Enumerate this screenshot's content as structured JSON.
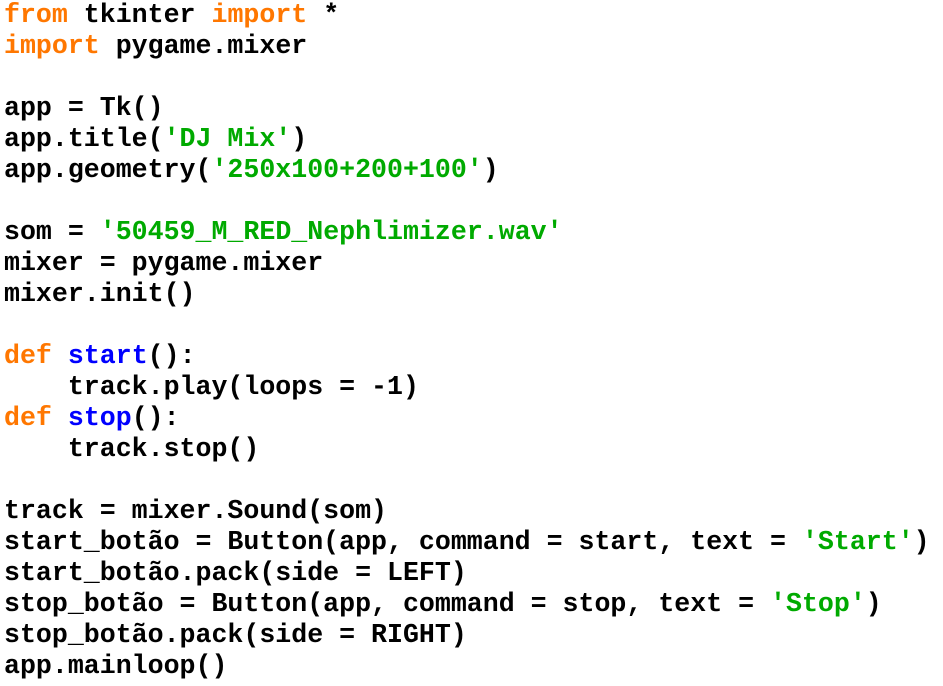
{
  "editor": {
    "colors": {
      "background": "#ffffff",
      "plain": "#000000",
      "keyword": "#ff7700",
      "function_name": "#0000ff",
      "string": "#00aa00"
    },
    "lines": [
      [
        {
          "t": "kw",
          "v": "from"
        },
        {
          "t": "plain",
          "v": " tkinter "
        },
        {
          "t": "kw",
          "v": "import"
        },
        {
          "t": "plain",
          "v": " *"
        }
      ],
      [
        {
          "t": "kw",
          "v": "import"
        },
        {
          "t": "plain",
          "v": " pygame.mixer"
        }
      ],
      [],
      [
        {
          "t": "plain",
          "v": "app = Tk()"
        }
      ],
      [
        {
          "t": "plain",
          "v": "app.title("
        },
        {
          "t": "str",
          "v": "'DJ Mix'"
        },
        {
          "t": "plain",
          "v": ")"
        }
      ],
      [
        {
          "t": "plain",
          "v": "app.geometry("
        },
        {
          "t": "str",
          "v": "'250x100+200+100'"
        },
        {
          "t": "plain",
          "v": ")"
        }
      ],
      [],
      [
        {
          "t": "plain",
          "v": "som = "
        },
        {
          "t": "str",
          "v": "'50459_M_RED_Nephlimizer.wav'"
        }
      ],
      [
        {
          "t": "plain",
          "v": "mixer = pygame.mixer"
        }
      ],
      [
        {
          "t": "plain",
          "v": "mixer.init()"
        }
      ],
      [],
      [
        {
          "t": "kw",
          "v": "def"
        },
        {
          "t": "plain",
          "v": " "
        },
        {
          "t": "fn",
          "v": "start"
        },
        {
          "t": "plain",
          "v": "():"
        }
      ],
      [
        {
          "t": "plain",
          "v": "    track.play(loops = -1)"
        }
      ],
      [
        {
          "t": "kw",
          "v": "def"
        },
        {
          "t": "plain",
          "v": " "
        },
        {
          "t": "fn",
          "v": "stop"
        },
        {
          "t": "plain",
          "v": "():"
        }
      ],
      [
        {
          "t": "plain",
          "v": "    track.stop()"
        }
      ],
      [],
      [
        {
          "t": "plain",
          "v": "track = mixer.Sound(som)"
        }
      ],
      [
        {
          "t": "plain",
          "v": "start_botão = Button(app, command = start, text = "
        },
        {
          "t": "str",
          "v": "'Start'"
        },
        {
          "t": "plain",
          "v": ")"
        }
      ],
      [
        {
          "t": "plain",
          "v": "start_botão.pack(side = LEFT)"
        }
      ],
      [
        {
          "t": "plain",
          "v": "stop_botão = Button(app, command = stop, text = "
        },
        {
          "t": "str",
          "v": "'Stop'"
        },
        {
          "t": "plain",
          "v": ")"
        }
      ],
      [
        {
          "t": "plain",
          "v": "stop_botão.pack(side = RIGHT)"
        }
      ],
      [
        {
          "t": "plain",
          "v": "app.mainloop()"
        }
      ]
    ]
  }
}
